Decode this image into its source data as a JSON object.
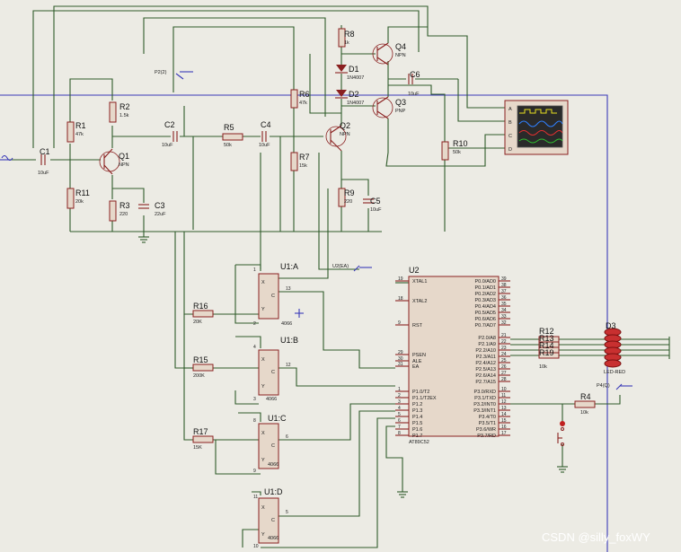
{
  "components": {
    "r1": {
      "ref": "R1",
      "value": "47k"
    },
    "r2": {
      "ref": "R2",
      "value": "1.5k"
    },
    "r3": {
      "ref": "R3",
      "value": "220"
    },
    "r4": {
      "ref": "R4",
      "value": "10k"
    },
    "r5": {
      "ref": "R5",
      "value": "50k"
    },
    "r6": {
      "ref": "R6",
      "value": "47k"
    },
    "r7": {
      "ref": "R7",
      "value": "15k"
    },
    "r8": {
      "ref": "R8",
      "value": "1k"
    },
    "r9": {
      "ref": "R9",
      "value": "220"
    },
    "r10": {
      "ref": "R10",
      "value": "50k"
    },
    "r11": {
      "ref": "R11",
      "value": "20k"
    },
    "r12": {
      "ref": "R12"
    },
    "r13": {
      "ref": "R13"
    },
    "r14": {
      "ref": "R14"
    },
    "r19": {
      "ref": "R19",
      "value": "10k"
    },
    "r15": {
      "ref": "R15",
      "value": "200K"
    },
    "r16": {
      "ref": "R16",
      "value": "20K"
    },
    "r17": {
      "ref": "R17",
      "value": "15K"
    },
    "c1": {
      "ref": "C1",
      "value": "10uF"
    },
    "c2": {
      "ref": "C2",
      "value": "10uF"
    },
    "c3": {
      "ref": "C3",
      "value": "22uF"
    },
    "c4": {
      "ref": "C4",
      "value": "10uF"
    },
    "c5": {
      "ref": "C5",
      "value": "10uF"
    },
    "c6": {
      "ref": "C6",
      "value": "10uF"
    },
    "q1": {
      "ref": "Q1",
      "type": "NPN"
    },
    "q2": {
      "ref": "Q2",
      "type": "NPN"
    },
    "q3": {
      "ref": "Q3",
      "type": "PNP"
    },
    "q4": {
      "ref": "Q4",
      "type": "NPN"
    },
    "d1": {
      "ref": "D1",
      "value": "1N4007"
    },
    "d2": {
      "ref": "D2",
      "value": "1N4007"
    },
    "d3": {
      "ref": "D3",
      "value": "LED-RED"
    },
    "u1a": {
      "ref": "U1:A",
      "part": "4066",
      "pin_x": "X",
      "pin_y": "Y",
      "pin_c": "C",
      "pin_in": "1",
      "pin_out": "2",
      "pin_ctl": "13"
    },
    "u1b": {
      "ref": "U1:B",
      "part": "4066",
      "pin_x": "X",
      "pin_y": "Y",
      "pin_c": "C",
      "pin_in": "4",
      "pin_out": "3",
      "pin_ctl": "12"
    },
    "u1c": {
      "ref": "U1:C",
      "part": "4066",
      "pin_x": "X",
      "pin_y": "Y",
      "pin_c": "C",
      "pin_in": "8",
      "pin_out": "9",
      "pin_ctl": "6"
    },
    "u1d": {
      "ref": "U1:D",
      "part": "4066",
      "pin_x": "X",
      "pin_y": "Y",
      "pin_c": "C",
      "pin_in": "11",
      "pin_out": "10",
      "pin_ctl": "5"
    },
    "u2": {
      "ref": "U2",
      "part": "AT89C52"
    }
  },
  "probes": {
    "p22": "P2(2)",
    "u2ea": "U2(EA)",
    "p4q": "P4(Q)"
  },
  "scope": {
    "channels": [
      "A",
      "B",
      "C",
      "D"
    ]
  },
  "mcu_left_pins": [
    {
      "num": "19",
      "name": "XTAL1"
    },
    {
      "num": "18",
      "name": "XTAL2"
    },
    {
      "num": "9",
      "name": "RST"
    },
    {
      "num": "29",
      "name": "PSEN"
    },
    {
      "num": "30",
      "name": "ALE"
    },
    {
      "num": "31",
      "name": "EA"
    },
    {
      "num": "1",
      "name": "P1.0/T2"
    },
    {
      "num": "2",
      "name": "P1.1/T2EX"
    },
    {
      "num": "3",
      "name": "P1.2"
    },
    {
      "num": "4",
      "name": "P1.3"
    },
    {
      "num": "5",
      "name": "P1.4"
    },
    {
      "num": "6",
      "name": "P1.5"
    },
    {
      "num": "7",
      "name": "P1.6"
    },
    {
      "num": "8",
      "name": "P1.7"
    }
  ],
  "mcu_right_pins": [
    {
      "num": "39",
      "name": "P0.0/AD0"
    },
    {
      "num": "38",
      "name": "P0.1/AD1"
    },
    {
      "num": "37",
      "name": "P0.2/AD2"
    },
    {
      "num": "36",
      "name": "P0.3/AD3"
    },
    {
      "num": "35",
      "name": "P0.4/AD4"
    },
    {
      "num": "34",
      "name": "P0.5/AD5"
    },
    {
      "num": "33",
      "name": "P0.6/AD6"
    },
    {
      "num": "32",
      "name": "P0.7/AD7"
    },
    {
      "num": "21",
      "name": "P2.0/A8"
    },
    {
      "num": "22",
      "name": "P2.1/A9"
    },
    {
      "num": "23",
      "name": "P2.2/A10"
    },
    {
      "num": "24",
      "name": "P2.3/A11"
    },
    {
      "num": "25",
      "name": "P2.4/A12"
    },
    {
      "num": "26",
      "name": "P2.5/A13"
    },
    {
      "num": "27",
      "name": "P2.6/A14"
    },
    {
      "num": "28",
      "name": "P2.7/A15"
    },
    {
      "num": "10",
      "name": "P3.0/RXD"
    },
    {
      "num": "11",
      "name": "P3.1/TXD"
    },
    {
      "num": "12",
      "name": "P3.2/INT0"
    },
    {
      "num": "13",
      "name": "P3.3/INT1"
    },
    {
      "num": "14",
      "name": "P3.4/T0"
    },
    {
      "num": "15",
      "name": "P3.5/T1"
    },
    {
      "num": "16",
      "name": "P3.6/WR"
    },
    {
      "num": "17",
      "name": "P3.7/RD"
    }
  ],
  "watermark": "CSDN @silly_foxWY",
  "colors": {
    "wire": "#2f5b2a",
    "part": "#8a2020",
    "probe": "#3a3ab8",
    "background": "#ecebe4"
  }
}
